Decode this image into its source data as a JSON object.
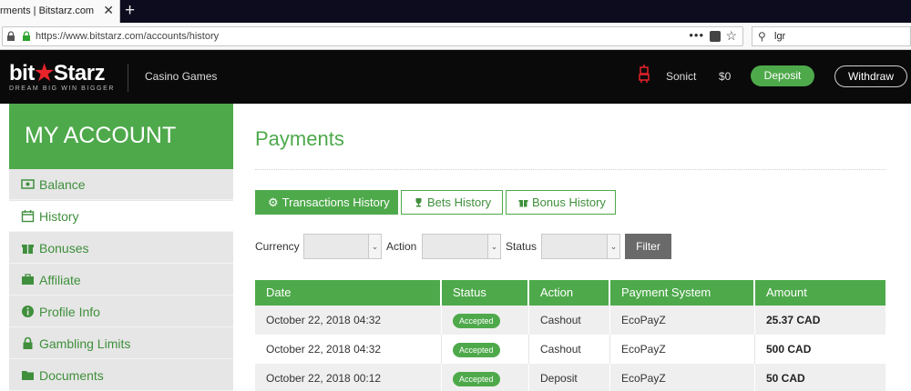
{
  "browser": {
    "tab_title": "rments | Bitstarz.com",
    "tab_close": "✕",
    "new_tab": "+",
    "url": "https://www.bitstarz.com/accounts/history",
    "url_more": "•••",
    "search_text": "lgr"
  },
  "header": {
    "logo_bit": "bit",
    "logo_star": "★",
    "logo_starz": "Starz",
    "tagline": "DREAM BIG  WIN BIGGER",
    "nav_casino": "Casino Games",
    "username": "Sonict",
    "balance": "$0",
    "deposit_label": "Deposit",
    "withdraw_label": "Withdraw",
    "accent_color": "#4ea94b",
    "brand_red": "#e8232a"
  },
  "sidebar": {
    "title": "MY ACCOUNT",
    "items": [
      {
        "label": "Balance",
        "icon": "money-icon"
      },
      {
        "label": "History",
        "icon": "calendar-icon"
      },
      {
        "label": "Bonuses",
        "icon": "gift-icon"
      },
      {
        "label": "Affiliate",
        "icon": "briefcase-icon"
      },
      {
        "label": "Profile Info",
        "icon": "info-icon"
      },
      {
        "label": "Gambling Limits",
        "icon": "lock-icon"
      },
      {
        "label": "Documents",
        "icon": "folder-icon"
      }
    ]
  },
  "main": {
    "title": "Payments",
    "tabs": [
      {
        "label": "Transactions History",
        "icon": "gear-icon"
      },
      {
        "label": "Bets History",
        "icon": "trophy-icon"
      },
      {
        "label": "Bonus History",
        "icon": "gift-icon"
      }
    ],
    "filters": {
      "currency_label": "Currency",
      "action_label": "Action",
      "status_label": "Status",
      "filter_button": "Filter",
      "arrow": "⌄"
    },
    "table": {
      "headers": [
        "Date",
        "Status",
        "Action",
        "Payment System",
        "Amount"
      ],
      "rows": [
        {
          "date": "October 22, 2018 04:32",
          "status": "Accepted",
          "action": "Cashout",
          "system": "EcoPayZ",
          "amount": "25.37 CAD"
        },
        {
          "date": "October 22, 2018 04:32",
          "status": "Accepted",
          "action": "Cashout",
          "system": "EcoPayZ",
          "amount": "500 CAD"
        },
        {
          "date": "October 22, 2018 00:12",
          "status": "Accepted",
          "action": "Deposit",
          "system": "EcoPayZ",
          "amount": "50 CAD"
        }
      ]
    }
  }
}
